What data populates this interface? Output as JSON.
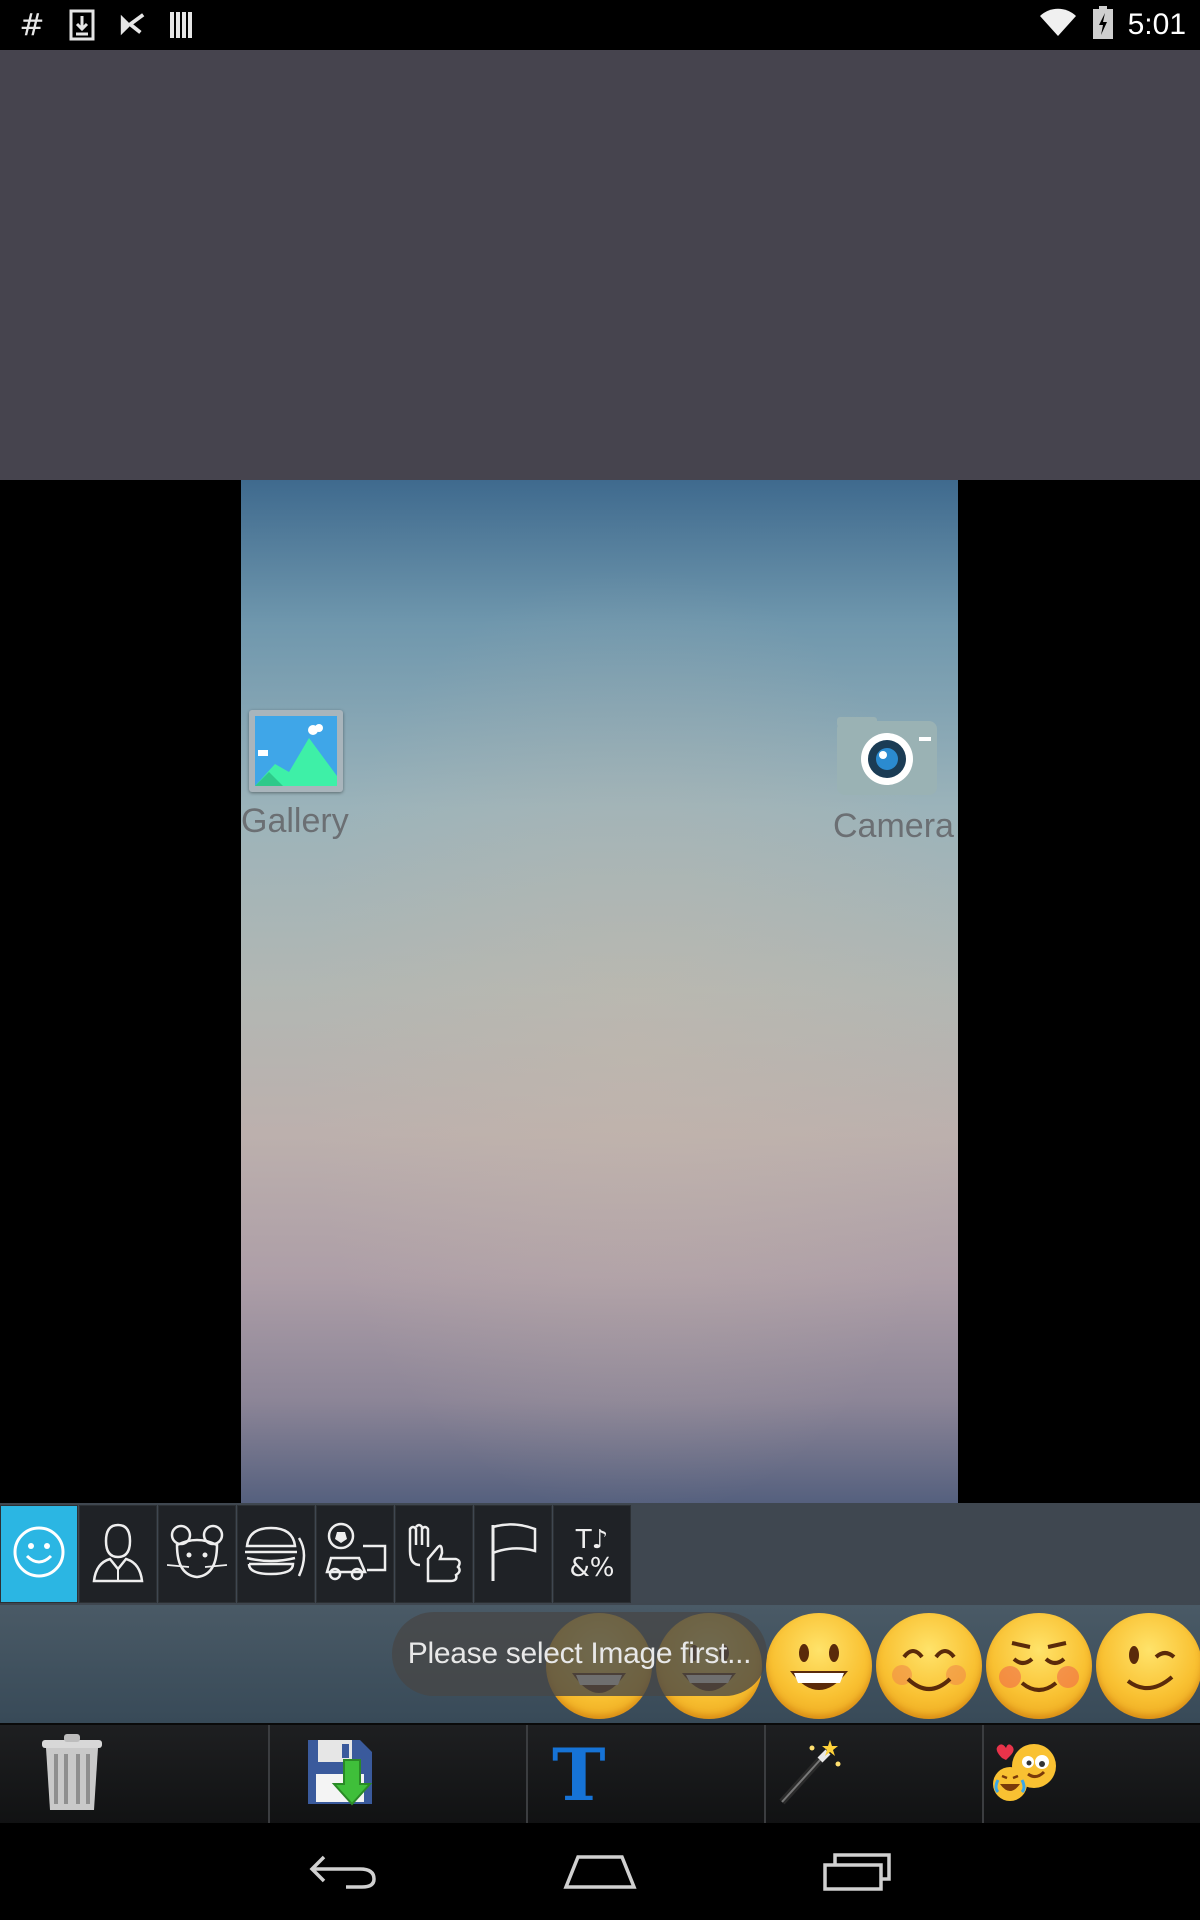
{
  "status_bar": {
    "time": "5:01",
    "left_icons": [
      "hash-icon",
      "download-icon",
      "play-store-icon",
      "barcode-icon"
    ],
    "right_icons": [
      "wifi-icon",
      "battery-charging-icon"
    ]
  },
  "canvas": {
    "gallery_label": "Gallery",
    "camera_label": "Camera"
  },
  "categories": [
    {
      "name": "smileys",
      "icon": "smiley-icon",
      "active": true
    },
    {
      "name": "people",
      "icon": "person-icon",
      "active": false
    },
    {
      "name": "animals",
      "icon": "mouse-animal-icon",
      "active": false
    },
    {
      "name": "food",
      "icon": "burger-icon",
      "active": false
    },
    {
      "name": "activities",
      "icon": "soccer-car-icon",
      "active": false
    },
    {
      "name": "gestures",
      "icon": "hand-thumbs-up-icon",
      "active": false
    },
    {
      "name": "flags",
      "icon": "flag-icon",
      "active": false
    },
    {
      "name": "symbols",
      "icon": "text-symbols-icon",
      "active": false,
      "label_lines": [
        "T♪",
        "&%"
      ]
    }
  ],
  "emojis": [
    "grinning-face",
    "grinning-face-2",
    "grinning-smile",
    "smiling-eyes",
    "relieved-smile",
    "winking-face"
  ],
  "toast": {
    "message": "Please select Image first..."
  },
  "toolbar": {
    "tools": [
      {
        "name": "delete",
        "icon": "trash-icon"
      },
      {
        "name": "save",
        "icon": "save-disk-icon"
      },
      {
        "name": "text",
        "icon": "text-T-icon",
        "label": "T"
      },
      {
        "name": "effects",
        "icon": "magic-wand-icon"
      },
      {
        "name": "emoji-picker",
        "icon": "emoji-sticker-icon"
      }
    ]
  },
  "nav_bar": {
    "buttons": [
      "back-icon",
      "home-icon",
      "recents-icon"
    ]
  },
  "colors": {
    "active_category": "#2bb6e3",
    "text_tool_blue": "#1673d6",
    "top_area": "#46444e"
  }
}
